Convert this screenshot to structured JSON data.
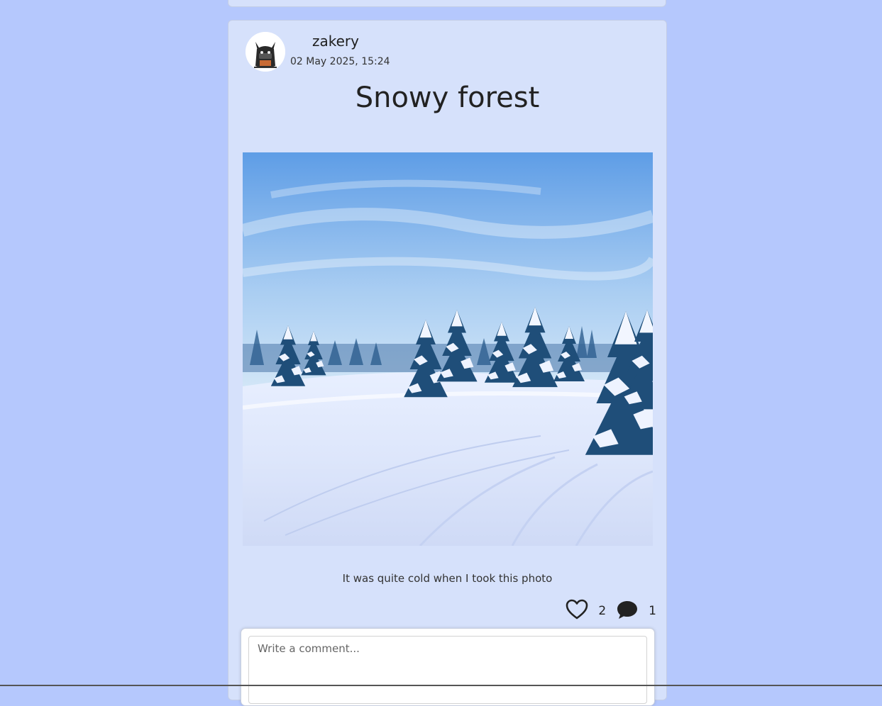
{
  "post": {
    "username": "zakery",
    "date": "02 May 2025, 15:24",
    "title": "Snowy forest",
    "image_alt": "snowy-forest-photo",
    "caption": "It was quite cold when I took this photo",
    "like_count": "2",
    "comment_count": "1"
  },
  "comment_form": {
    "placeholder": "Write a comment..."
  },
  "icons": {
    "like": "heart-icon",
    "comment": "speech-bubble-icon",
    "avatar": "cat-avatar"
  },
  "colors": {
    "page_background": "#b5c8fd",
    "card_background": "#d6e1fb",
    "text": "#222222"
  }
}
